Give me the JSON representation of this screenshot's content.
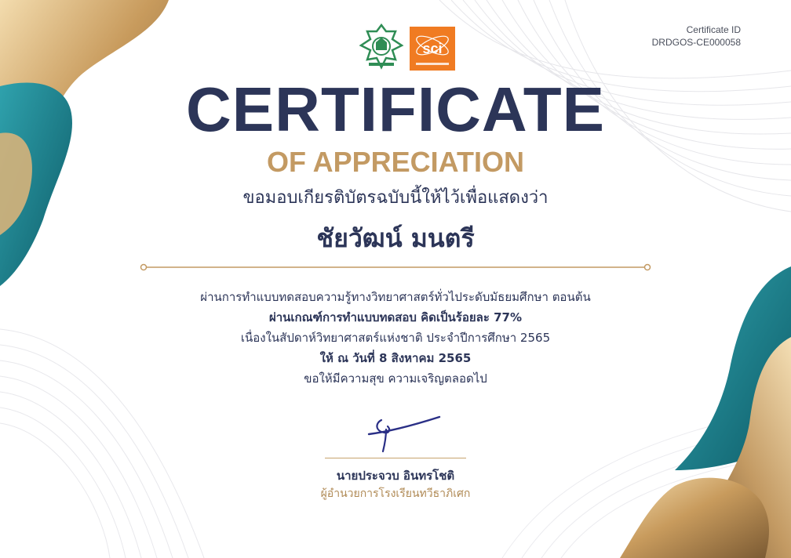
{
  "certificate_id": {
    "label": "Certificate ID",
    "value": "DRDGOS-CE000058"
  },
  "title": "CERTIFICATE",
  "subtitle": "OF APPRECIATION",
  "intro": "ขอมอบเกียรติบัตรฉบับนี้ให้ไว้เพื่อแสดงว่า",
  "recipient_name": "ชัยวัฒน์ มนตรี",
  "body_lines": [
    "ผ่านการทำแบบทดสอบความรู้ทางวิทยาศาสตร์ทั่วไประดับมัธยมศึกษา ตอนต้น",
    "ผ่านเกณฑ์การทำแบบทดสอบ คิดเป็นร้อยละ  77%",
    "เนื่องในสัปดาห์วิทยาศาสตร์แห่งชาติ ประจำปีการศึกษา 2565",
    "ให้ ณ วันที่ 8 สิงหาคม 2565",
    "ขอให้มีความสุข ความเจริญตลอดไป"
  ],
  "signer": {
    "name": "นายประจวบ  อินทรโชติ",
    "position": "ผู้อำนวยการโรงเรียนทวีธาภิเศก"
  },
  "logos": {
    "right_logo_text": "sci"
  },
  "colors": {
    "navy": "#2c3558",
    "gold": "#c39a63",
    "teal": "#1a7f8c",
    "green": "#2f8d55",
    "orange": "#f07b22"
  }
}
